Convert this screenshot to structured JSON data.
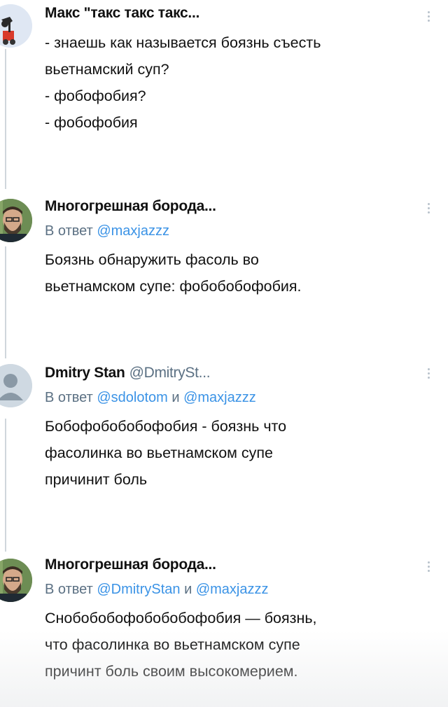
{
  "tweets": [
    {
      "author": "Макс \"такс такс такс...",
      "avatar": "cartoon-avatar-icon",
      "body": "- знаешь как называется боязнь съесть\nвьетнамский суп?\n- фобофобия?\n- фобофобия"
    },
    {
      "author": "Многогрешная борода...",
      "avatar": "bearded-man-photo",
      "reply_prefix": "В ответ",
      "mention1": "@maxjazzz",
      "body": "Боязнь обнаружить фасоль во\nвьетнамском супе: фобобобофобия."
    },
    {
      "author": "Dmitry Stan",
      "handle": "@DmitrySt...",
      "avatar": "default-user-icon",
      "reply_prefix": "В ответ",
      "mention1": "@sdolotom",
      "conjunction": "и",
      "mention2": "@maxjazzz",
      "body": "Бобофобобобофобия - боязнь что\nфасолинка во вьетнамском супе\nпричинит боль"
    },
    {
      "author": "Многогрешная борода...",
      "avatar": "bearded-man-photo",
      "reply_prefix": "В ответ",
      "mention1": "@DmitryStan",
      "conjunction": "и",
      "mention2": "@maxjazzz",
      "body": "Снобобобофобобобофобия — боязнь,\nчто фасолинка во вьетнамском супе\nпричинт боль своим высокомерием."
    }
  ],
  "colors": {
    "text": "#111111",
    "muted": "#5b7083",
    "link": "#3b93e6",
    "thread_line": "#cfd6dc"
  }
}
